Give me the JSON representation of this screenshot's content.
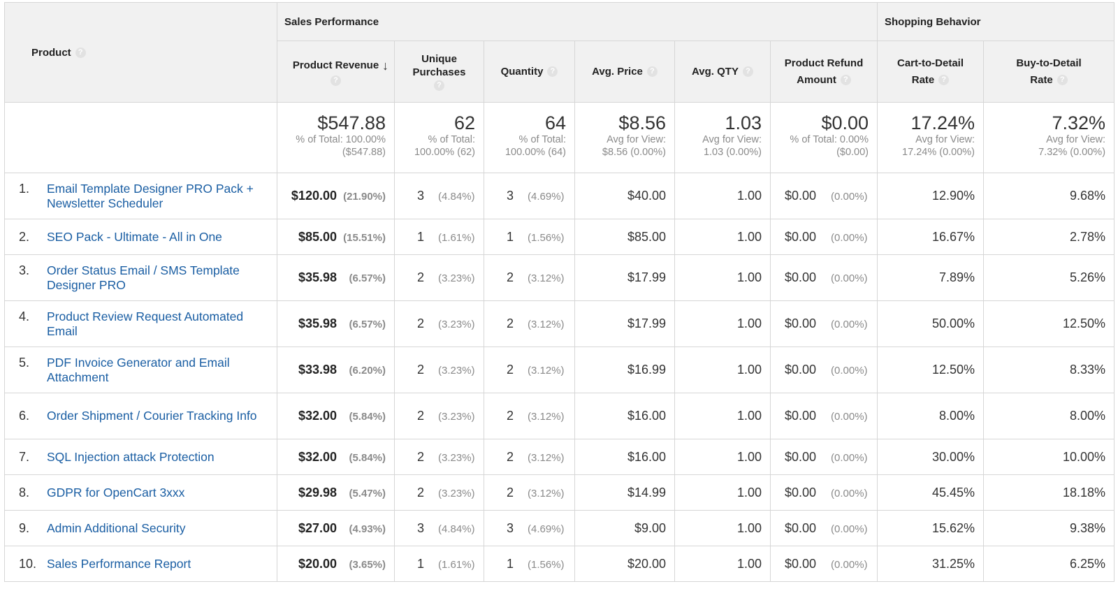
{
  "headers": {
    "product": "Product",
    "group_sales": "Sales Performance",
    "group_shopping": "Shopping Behavior",
    "revenue": "Product Revenue",
    "unique_line1": "Unique",
    "unique_line2": "Purchases",
    "quantity": "Quantity",
    "avg_price": "Avg. Price",
    "avg_qty": "Avg. QTY",
    "refund_line1": "Product Refund",
    "refund_line2": "Amount",
    "cart_line1": "Cart-to-Detail",
    "cart_line2": "Rate",
    "buy_line1": "Buy-to-Detail",
    "buy_line2": "Rate",
    "help_glyph": "?",
    "sort_glyph": "↓"
  },
  "totals": {
    "revenue": {
      "value": "$547.88",
      "sub1": "% of Total: 100.00%",
      "sub2": "($547.88)"
    },
    "unique": {
      "value": "62",
      "sub1": "% of Total:",
      "sub2": "100.00% (62)"
    },
    "quantity": {
      "value": "64",
      "sub1": "% of Total:",
      "sub2": "100.00% (64)"
    },
    "avg_price": {
      "value": "$8.56",
      "sub1": "Avg for View:",
      "sub2": "$8.56 (0.00%)"
    },
    "avg_qty": {
      "value": "1.03",
      "sub1": "Avg for View:",
      "sub2": "1.03 (0.00%)"
    },
    "refund": {
      "value": "$0.00",
      "sub1": "% of Total: 0.00%",
      "sub2": "($0.00)"
    },
    "cart": {
      "value": "17.24%",
      "sub1": "Avg for View:",
      "sub2": "17.24% (0.00%)"
    },
    "buy": {
      "value": "7.32%",
      "sub1": "Avg for View:",
      "sub2": "7.32% (0.00%)"
    }
  },
  "rows": [
    {
      "num": "1.",
      "name": "Email Template Designer PRO Pack + Newsletter Scheduler",
      "revenue": "$120.00",
      "revenue_pct": "(21.90%)",
      "unique": "3",
      "unique_pct": "(4.84%)",
      "quantity": "3",
      "quantity_pct": "(4.69%)",
      "avg_price": "$40.00",
      "avg_qty": "1.00",
      "refund": "$0.00",
      "refund_pct": "(0.00%)",
      "cart": "12.90%",
      "buy": "9.68%"
    },
    {
      "num": "2.",
      "name": "SEO Pack - Ultimate - All in One",
      "revenue": "$85.00",
      "revenue_pct": "(15.51%)",
      "unique": "1",
      "unique_pct": "(1.61%)",
      "quantity": "1",
      "quantity_pct": "(1.56%)",
      "avg_price": "$85.00",
      "avg_qty": "1.00",
      "refund": "$0.00",
      "refund_pct": "(0.00%)",
      "cart": "16.67%",
      "buy": "2.78%"
    },
    {
      "num": "3.",
      "name": "Order Status Email / SMS Template Designer PRO",
      "revenue": "$35.98",
      "revenue_pct": "(6.57%)",
      "unique": "2",
      "unique_pct": "(3.23%)",
      "quantity": "2",
      "quantity_pct": "(3.12%)",
      "avg_price": "$17.99",
      "avg_qty": "1.00",
      "refund": "$0.00",
      "refund_pct": "(0.00%)",
      "cart": "7.89%",
      "buy": "5.26%"
    },
    {
      "num": "4.",
      "name": "Product Review Request Automated Email",
      "revenue": "$35.98",
      "revenue_pct": "(6.57%)",
      "unique": "2",
      "unique_pct": "(3.23%)",
      "quantity": "2",
      "quantity_pct": "(3.12%)",
      "avg_price": "$17.99",
      "avg_qty": "1.00",
      "refund": "$0.00",
      "refund_pct": "(0.00%)",
      "cart": "50.00%",
      "buy": "12.50%"
    },
    {
      "num": "5.",
      "name": "PDF Invoice Generator and Email Attachment",
      "revenue": "$33.98",
      "revenue_pct": "(6.20%)",
      "unique": "2",
      "unique_pct": "(3.23%)",
      "quantity": "2",
      "quantity_pct": "(3.12%)",
      "avg_price": "$16.99",
      "avg_qty": "1.00",
      "refund": "$0.00",
      "refund_pct": "(0.00%)",
      "cart": "12.50%",
      "buy": "8.33%"
    },
    {
      "num": "6.",
      "name": "Order Shipment / Courier Tracking Info",
      "revenue": "$32.00",
      "revenue_pct": "(5.84%)",
      "unique": "2",
      "unique_pct": "(3.23%)",
      "quantity": "2",
      "quantity_pct": "(3.12%)",
      "avg_price": "$16.00",
      "avg_qty": "1.00",
      "refund": "$0.00",
      "refund_pct": "(0.00%)",
      "cart": "8.00%",
      "buy": "8.00%"
    },
    {
      "num": "7.",
      "name": "SQL Injection attack Protection",
      "revenue": "$32.00",
      "revenue_pct": "(5.84%)",
      "unique": "2",
      "unique_pct": "(3.23%)",
      "quantity": "2",
      "quantity_pct": "(3.12%)",
      "avg_price": "$16.00",
      "avg_qty": "1.00",
      "refund": "$0.00",
      "refund_pct": "(0.00%)",
      "cart": "30.00%",
      "buy": "10.00%"
    },
    {
      "num": "8.",
      "name": "GDPR for OpenCart 3xxx",
      "revenue": "$29.98",
      "revenue_pct": "(5.47%)",
      "unique": "2",
      "unique_pct": "(3.23%)",
      "quantity": "2",
      "quantity_pct": "(3.12%)",
      "avg_price": "$14.99",
      "avg_qty": "1.00",
      "refund": "$0.00",
      "refund_pct": "(0.00%)",
      "cart": "45.45%",
      "buy": "18.18%"
    },
    {
      "num": "9.",
      "name": "Admin Additional Security",
      "revenue": "$27.00",
      "revenue_pct": "(4.93%)",
      "unique": "3",
      "unique_pct": "(4.84%)",
      "quantity": "3",
      "quantity_pct": "(4.69%)",
      "avg_price": "$9.00",
      "avg_qty": "1.00",
      "refund": "$0.00",
      "refund_pct": "(0.00%)",
      "cart": "15.62%",
      "buy": "9.38%"
    },
    {
      "num": "10.",
      "name": "Sales Performance Report",
      "revenue": "$20.00",
      "revenue_pct": "(3.65%)",
      "unique": "1",
      "unique_pct": "(1.61%)",
      "quantity": "1",
      "quantity_pct": "(1.56%)",
      "avg_price": "$20.00",
      "avg_qty": "1.00",
      "refund": "$0.00",
      "refund_pct": "(0.00%)",
      "cart": "31.25%",
      "buy": "6.25%"
    }
  ]
}
